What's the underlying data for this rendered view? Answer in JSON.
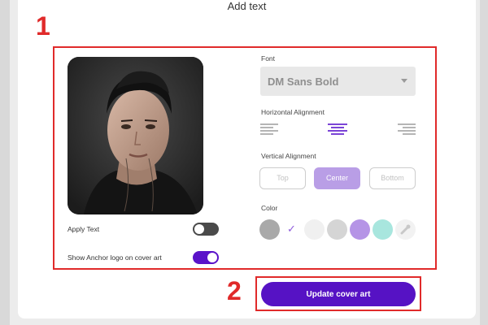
{
  "dialog": {
    "title": "Add text"
  },
  "annotations": {
    "step1": "1",
    "step2": "2"
  },
  "options": {
    "apply_text_label": "Apply Text",
    "apply_text_on": false,
    "show_logo_label": "Show Anchor logo on cover art",
    "show_logo_on": true
  },
  "font": {
    "label": "Font",
    "selected": "DM Sans Bold"
  },
  "horizontal_alignment": {
    "label": "Horizontal Alignment",
    "options": [
      "left",
      "center",
      "right"
    ],
    "selected": "center"
  },
  "vertical_alignment": {
    "label": "Vertical Alignment",
    "options": [
      "Top",
      "Center",
      "Bottom"
    ],
    "selected": "Center"
  },
  "color": {
    "label": "Color",
    "swatches": [
      "#a9a9a9",
      "#ffffff",
      "#f0f0f0",
      "#d5d5d5",
      "#b594e6",
      "#a8e6de",
      "#f2f2f2"
    ],
    "selected_index": 1,
    "last_is_eyedropper": true
  },
  "update_button": {
    "label": "Update cover art"
  },
  "accent_color": "#5612c4",
  "annotation_color": "#e02a2a"
}
